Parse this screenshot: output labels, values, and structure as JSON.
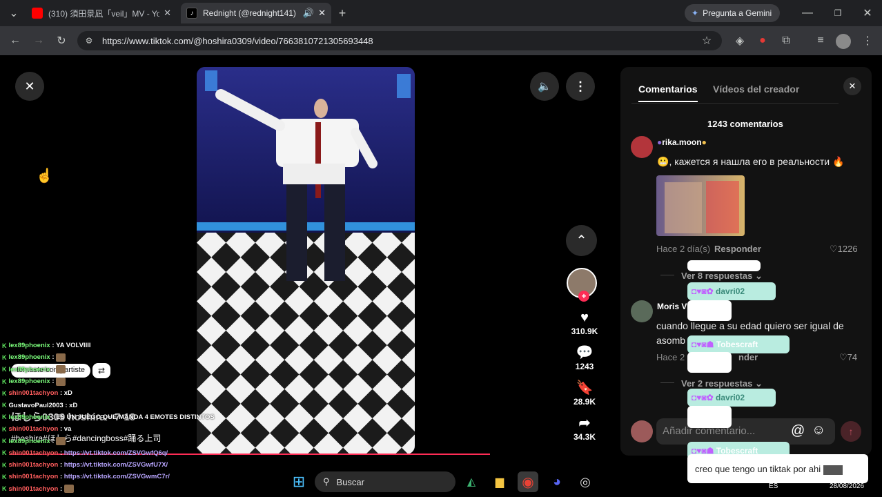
{
  "browser": {
    "tabs": [
      {
        "title": "(310) 須田景凪「veil」MV - YouTub",
        "icon": "youtube-icon"
      },
      {
        "title": "Rednight (@rednight141) |",
        "icon": "tiktok-icon"
      }
    ],
    "gemini_label": "Pregunta a Gemini",
    "url": "https://www.tiktok.com/@hoshira0309/video/7663810721305693448"
  },
  "video": {
    "author_line": "ほしら0309 hoshira · 7-18",
    "caption": "#hoshira#ほしら#dancingboss#踊る上司",
    "share_chip": "tomaste compartiste",
    "actions": {
      "likes": "310.9K",
      "comments": "1243",
      "saves": "28.9K",
      "shares": "34.3K"
    }
  },
  "comments_panel": {
    "tabs": [
      "Comentarios",
      "Vídeos del creador"
    ],
    "count_label": "1243 comentarios",
    "comments": [
      {
        "user": "rika.moon",
        "text": ", кажется я нашла его в реальности",
        "time": "Hace 2 día(s)",
        "reply": "Responder",
        "likes": "1226",
        "more": "Ver 8 respuestas"
      },
      {
        "user": "Moris V",
        "text": "cuando llegue a su edad quiero ser igual de asomb",
        "time": "Hace 2",
        "reply": "nder",
        "likes": "74",
        "more": "Ver 2 respuestas"
      }
    ],
    "input_placeholder": "Añadir comentario..."
  },
  "overlay_emotes": [
    {
      "user": "davri02"
    },
    {
      "user": "Tobescraft"
    },
    {
      "user": "davri02"
    },
    {
      "user": "Tobescraft"
    }
  ],
  "overlay_message": "creo que tengo un tiktak por ahi",
  "chat": [
    {
      "user": "lex89phoenix",
      "msg": "YA VOLVIIII",
      "color": "#7cff7c"
    },
    {
      "user": "lex89phoenix",
      "msg": "",
      "color": "#7cff7c"
    },
    {
      "user": "lex89phoenix",
      "msg": "",
      "color": "#7cff7c"
    },
    {
      "user": "lex89phoenix",
      "msg": "",
      "color": "#7cff7c"
    },
    {
      "user": "shin001tachyon",
      "msg": "xD",
      "color": "#ff5d5d"
    },
    {
      "user": "GustavoPaul2003",
      "msg": "xD",
      "color": "#ffffff"
    },
    {
      "user": "lex89phoenix",
      "msg": "ES UN JUEGO QUE MANDA 4 EMOTES DISTINTOS",
      "color": "#7cff7c"
    },
    {
      "user": "shin001tachyon",
      "msg": "va",
      "color": "#ff5d5d"
    },
    {
      "user": "lex89phoenix",
      "msg": "",
      "color": "#7cff7c"
    },
    {
      "user": "shin001tachyon",
      "msg": "https://vt.tiktok.com/ZSVGwfQ6q/",
      "color": "#ff5d5d"
    },
    {
      "user": "shin001tachyon",
      "msg": "https://vt.tiktok.com/ZSVGwfU7X/",
      "color": "#ff5d5d"
    },
    {
      "user": "shin001tachyon",
      "msg": "https://vt.tiktok.com/ZSVGwmC7r/",
      "color": "#ff5d5d"
    },
    {
      "user": "shin001tachyon",
      "msg": "",
      "color": "#ff5d5d"
    }
  ],
  "taskbar": {
    "search_label": "Buscar",
    "lang": "ES",
    "date": "28/08/2026"
  }
}
